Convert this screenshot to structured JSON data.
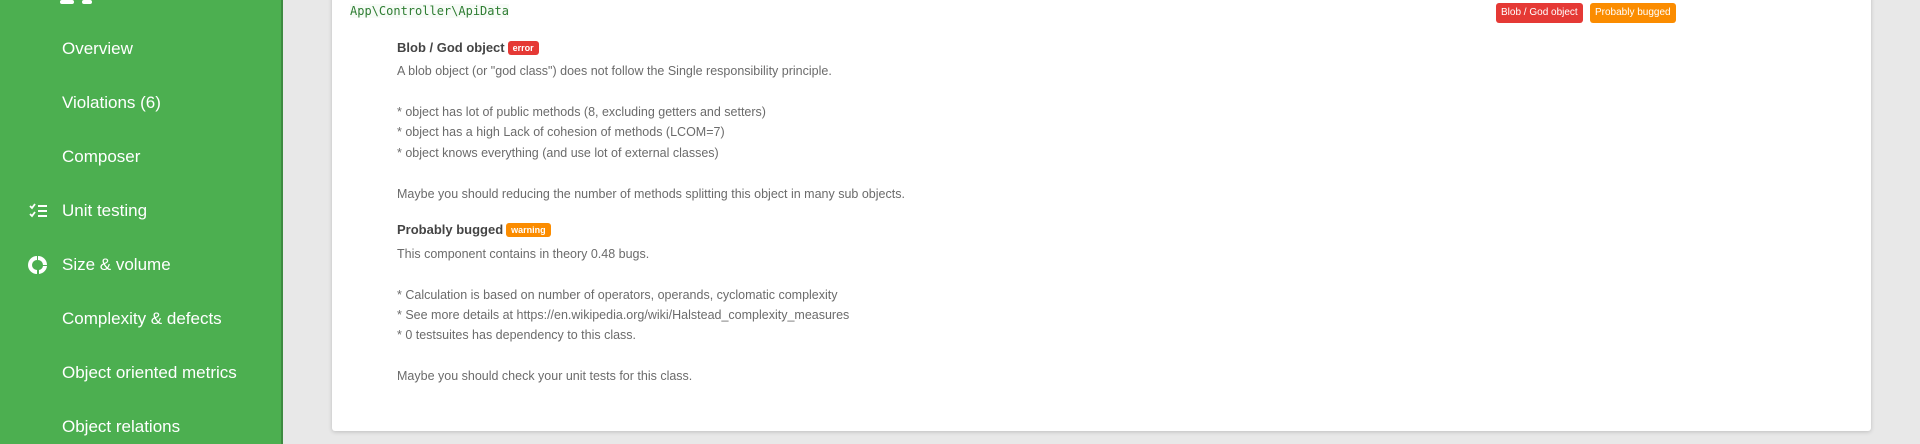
{
  "sidebar": {
    "items": [
      {
        "label": "Overview",
        "icon": ""
      },
      {
        "label": "Violations (6)",
        "icon": ""
      },
      {
        "label": "Composer",
        "icon": ""
      },
      {
        "label": "Unit testing",
        "icon": "checklist-icon"
      },
      {
        "label": "Size & volume",
        "icon": "donut-chart-icon"
      },
      {
        "label": "Complexity & defects",
        "icon": ""
      },
      {
        "label": "Object oriented metrics",
        "icon": ""
      },
      {
        "label": "Object relations",
        "icon": ""
      }
    ]
  },
  "card": {
    "class_name": "App\\Controller\\ApiData",
    "badges": [
      {
        "label": "Blob / God object",
        "level": "error"
      },
      {
        "label": "Probably bugged",
        "level": "warning"
      }
    ],
    "violations": [
      {
        "title": "Blob / God object",
        "tag": "error",
        "lines": [
          "A blob object (or \"god class\") does not follow the Single responsibility principle.",
          "* object has lot of public methods (8, excluding getters and setters)",
          "* object has a high Lack of cohesion of methods (LCOM=7)",
          "* object knows everything (and use lot of external classes)",
          "Maybe you should reducing the number of methods splitting this object in many sub objects."
        ]
      },
      {
        "title": "Probably bugged",
        "tag": "warning",
        "lines": [
          "This component contains in theory 0.48 bugs.",
          "* Calculation is based on number of operators, operands, cyclomatic complexity",
          "* See more details at https://en.wikipedia.org/wiki/Halstead_complexity_measures",
          "* 0 testsuites has dependency to this class.",
          "Maybe you should check your unit tests for this class."
        ]
      }
    ]
  },
  "colors": {
    "sidebar": "#4caf50",
    "error": "#e53935",
    "warning": "#fb8c00",
    "class_name": "#2e7d32"
  }
}
